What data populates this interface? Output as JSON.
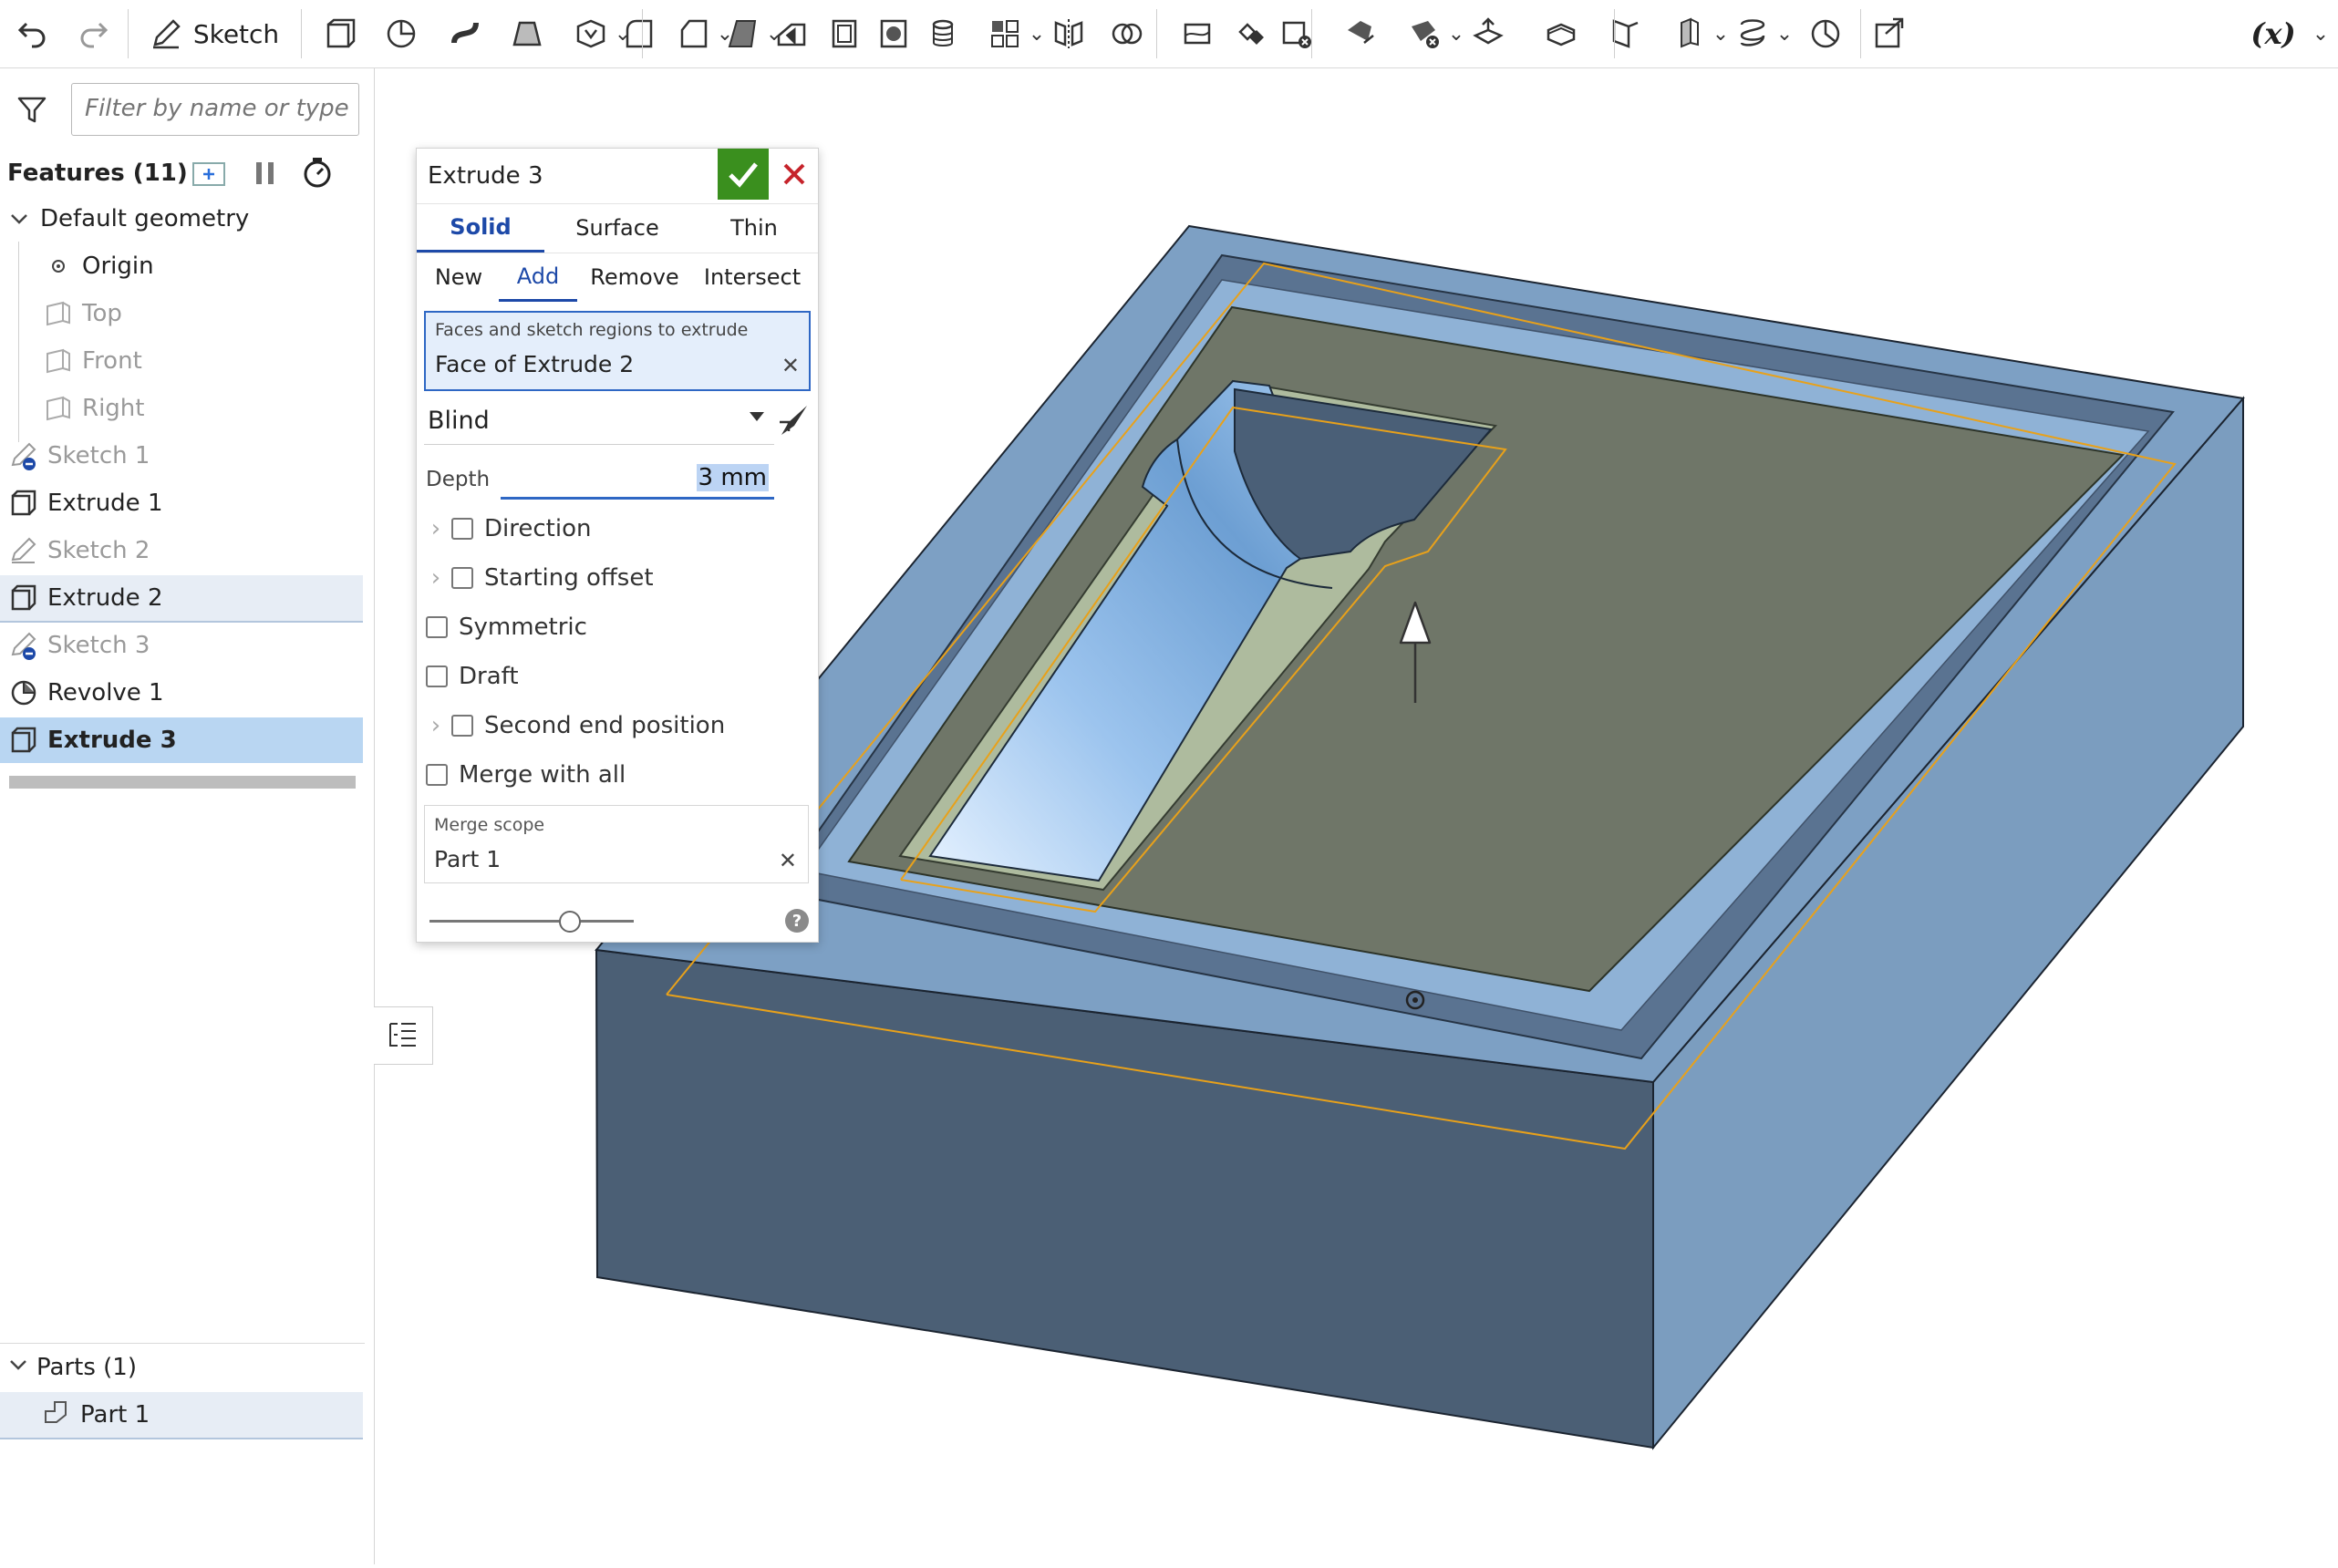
{
  "toolbar": {
    "sketch_label": "Sketch",
    "fx_label": "(x)",
    "icons": [
      "undo-icon",
      "redo-icon",
      "sketch-icon",
      "extrude-icon",
      "revolve-icon",
      "sweep-icon",
      "loft-icon",
      "thicken-icon",
      "fillet-icon",
      "chamfer-icon",
      "draft-icon",
      "rib-icon",
      "shell-icon",
      "hole-icon",
      "thread-icon",
      "pattern-icon",
      "mirror-icon",
      "boolean-icon",
      "split-icon",
      "transform-icon",
      "delete-part-icon",
      "move-face-icon",
      "replace-face-icon",
      "offset-surface-icon",
      "boundary-surface-icon",
      "sheet-metal-icon",
      "frame-icon",
      "helix-icon",
      "measure-icon",
      "import-icon",
      "variable-icon"
    ]
  },
  "left_panel": {
    "filter_placeholder": "Filter by name or type",
    "features_header": "Features (11)",
    "tree": [
      {
        "label": "Default geometry",
        "type": "group"
      },
      {
        "label": "Origin",
        "type": "origin"
      },
      {
        "label": "Top",
        "type": "plane"
      },
      {
        "label": "Front",
        "type": "plane"
      },
      {
        "label": "Right",
        "type": "plane"
      },
      {
        "label": "Sketch 1",
        "type": "sketch"
      },
      {
        "label": "Extrude 1",
        "type": "extrude"
      },
      {
        "label": "Sketch 2",
        "type": "sketch"
      },
      {
        "label": "Extrude 2",
        "type": "extrude"
      },
      {
        "label": "Sketch 3",
        "type": "sketch"
      },
      {
        "label": "Revolve 1",
        "type": "revolve"
      },
      {
        "label": "Extrude 3",
        "type": "extrude"
      }
    ],
    "parts_header": "Parts (1)",
    "parts": [
      "Part 1"
    ]
  },
  "dialog": {
    "title": "Extrude 3",
    "body_tabs": [
      "Solid",
      "Surface",
      "Thin"
    ],
    "active_body_tab": "Solid",
    "op_tabs": [
      "New",
      "Add",
      "Remove",
      "Intersect"
    ],
    "active_op_tab": "Add",
    "faces_label": "Faces and sketch regions to extrude",
    "faces_value": "Face of Extrude 2",
    "end_type": "Blind",
    "depth_label": "Depth",
    "depth_value": "3 mm",
    "options": {
      "direction": "Direction",
      "starting_offset": "Starting offset",
      "symmetric": "Symmetric",
      "draft": "Draft",
      "second_end": "Second end position",
      "merge_all": "Merge with all"
    },
    "merge_scope_label": "Merge scope",
    "merge_scope_value": "Part 1",
    "help_glyph": "?"
  },
  "colors": {
    "accent": "#1d49a8",
    "accept": "#3a8f1e",
    "cancel": "#c6232b",
    "tree_selection": "#b9d6f2",
    "model_top": "#7da0c4",
    "model_front": "#4b5f75",
    "model_side": "#7b9dbf",
    "region": "#6f7668",
    "edge_highlight": "#e8a11a"
  }
}
